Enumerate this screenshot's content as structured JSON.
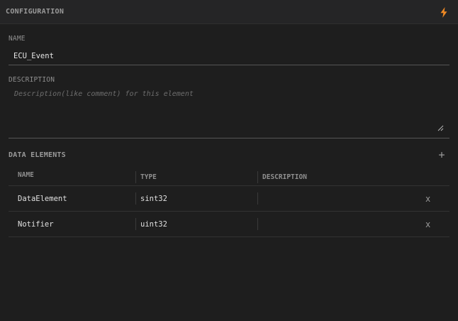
{
  "header": {
    "title": "CONFIGURATION",
    "action_icon": "lightning-bolt-icon",
    "accent": "#f08a24"
  },
  "name_field": {
    "label": "NAME",
    "value": "ECU_Event"
  },
  "description_field": {
    "label": "DESCRIPTION",
    "value": "",
    "placeholder": "Description(like comment) for this element"
  },
  "data_elements": {
    "title": "DATA ELEMENTS",
    "add_label": "+",
    "columns": [
      "NAME",
      "TYPE",
      "DESCRIPTION",
      ""
    ],
    "rows": [
      {
        "name": "DataElement",
        "type": "sint32",
        "description": "",
        "delete_label": "x"
      },
      {
        "name": "Notifier",
        "type": "uint32",
        "description": "",
        "delete_label": "x"
      }
    ]
  }
}
